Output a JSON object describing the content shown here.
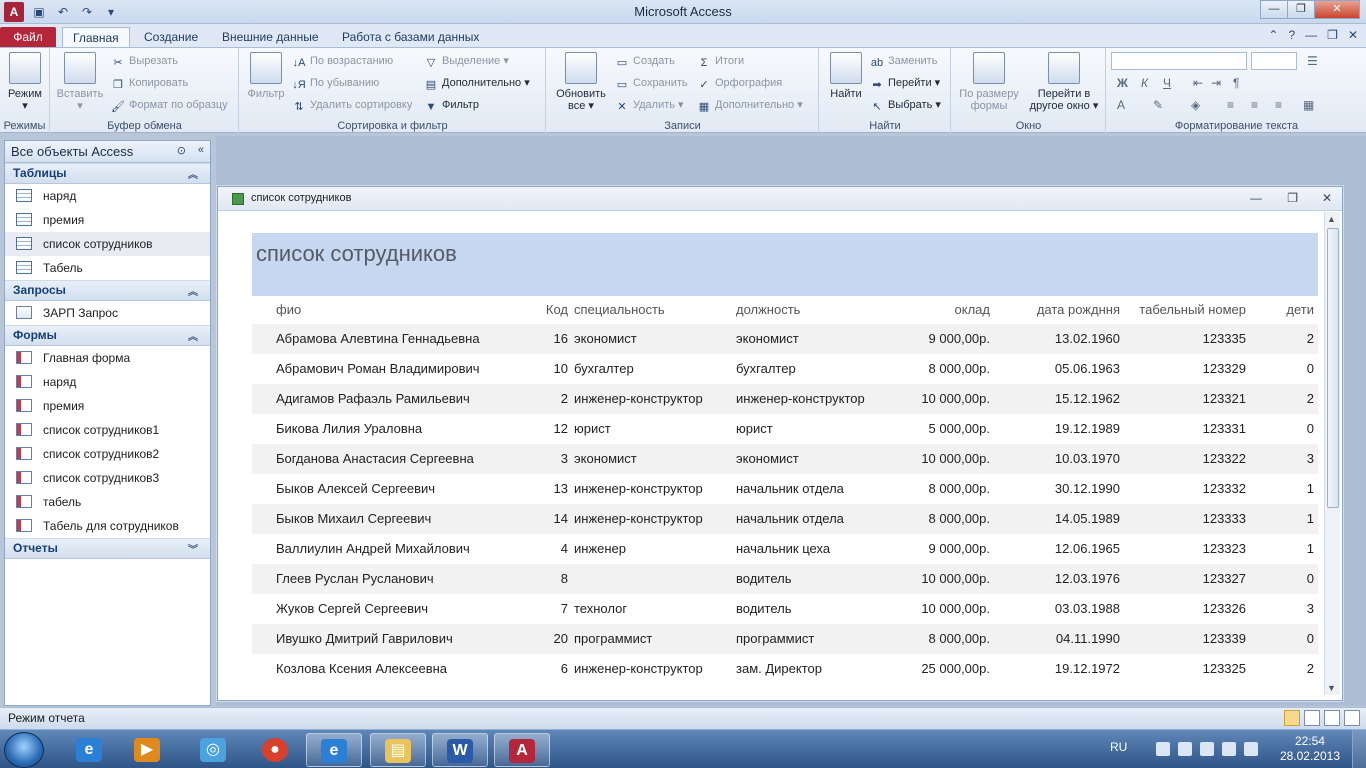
{
  "window": {
    "title": "Microsoft Access"
  },
  "ribbon_tabs": [
    "Файл",
    "Главная",
    "Создание",
    "Внешние данные",
    "Работа с базами данных"
  ],
  "groups": {
    "rezhimy": {
      "label": "Режимы",
      "rezhim": "Режим"
    },
    "bufer": {
      "label": "Буфер обмена",
      "vstavit": "Вставить",
      "vyrezat": "Вырезать",
      "kopirovat": "Копировать",
      "format": "Формат по образцу"
    },
    "sort": {
      "label": "Сортировка и фильтр",
      "filtr": "Фильтр",
      "asc": "По возрастанию",
      "desc": "По убыванию",
      "remove": "Удалить сортировку",
      "vydelenie": "Выделение",
      "dop": "Дополнительно",
      "filtr2": "Фильтр"
    },
    "zapisi": {
      "label": "Записи",
      "obnovit1": "Обновить",
      "obnovit2": "все",
      "sozdat": "Создать",
      "sohranit": "Сохранить",
      "udalit": "Удалить",
      "itogi": "Итоги",
      "orfo": "Орфография",
      "dop": "Дополнительно"
    },
    "nayti": {
      "label": "Найти",
      "nayti": "Найти",
      "zamenit": "Заменить",
      "pereyti": "Перейти",
      "vybrat": "Выбрать"
    },
    "okno": {
      "label": "Окно",
      "razmer1": "По размеру",
      "razmer2": "формы",
      "pereyti1": "Перейти в",
      "pereyti2": "другое окно"
    },
    "format": {
      "label": "Форматирование текста",
      "bold": "Ж",
      "italic": "К",
      "underline": "Ч",
      "fontcolor": "А"
    }
  },
  "nav": {
    "title": "Все объекты Access",
    "sections": [
      {
        "name": "Таблицы",
        "items": [
          "наряд",
          "премия",
          "список сотрудников",
          "Табель"
        ]
      },
      {
        "name": "Запросы",
        "items": [
          "ЗАРП Запрос"
        ]
      },
      {
        "name": "Формы",
        "items": [
          "Главная форма",
          "наряд",
          "премия",
          "список сотрудников1",
          "список сотрудников2",
          "список сотрудников3",
          "табель",
          "Табель для сотрудников"
        ]
      },
      {
        "name": "Отчеты",
        "items": []
      }
    ]
  },
  "report": {
    "window_title": "список сотрудников",
    "heading": "список сотрудников",
    "columns": [
      "фио",
      "Код",
      "специальность",
      "должность",
      "оклад",
      "дата рождння",
      "табельный номер",
      "дети"
    ],
    "rows": [
      [
        "Абрамова Алевтина Геннадьевна",
        "16",
        "экономист",
        "экономист",
        "9 000,00р.",
        "13.02.1960",
        "123335",
        "2"
      ],
      [
        "Абрамович Роман Владимирович",
        "10",
        "бухгалтер",
        "бухгалтер",
        "8 000,00р.",
        "05.06.1963",
        "123329",
        "0"
      ],
      [
        "Адигамов Рафаэль Рамильевич",
        "2",
        "инженер-конструктор",
        "инженер-конструктор",
        "10 000,00р.",
        "15.12.1962",
        "123321",
        "2"
      ],
      [
        "Бикова Лилия Ураловна",
        "12",
        "юрист",
        "юрист",
        "5 000,00р.",
        "19.12.1989",
        "123331",
        "0"
      ],
      [
        "Богданова Анастасия Сергеевна",
        "3",
        "экономист",
        "экономист",
        "10 000,00р.",
        "10.03.1970",
        "123322",
        "3"
      ],
      [
        "Быков Алексей Сергеевич",
        "13",
        "инженер-конструктор",
        "начальник отдела",
        "8 000,00р.",
        "30.12.1990",
        "123332",
        "1"
      ],
      [
        "Быков Михаил Сергеевич",
        "14",
        "инженер-конструктор",
        "начальник отдела",
        "8 000,00р.",
        "14.05.1989",
        "123333",
        "1"
      ],
      [
        "Валлиулин Андрей Михайлович",
        "4",
        "инженер",
        "начальник цеха",
        "9 000,00р.",
        "12.06.1965",
        "123323",
        "1"
      ],
      [
        "Глеев Руслан Русланович",
        "8",
        "",
        "водитель",
        "10 000,00р.",
        "12.03.1976",
        "123327",
        "0"
      ],
      [
        "Жуков Сергей Сергеевич",
        "7",
        "технолог",
        "водитель",
        "10 000,00р.",
        "03.03.1988",
        "123326",
        "3"
      ],
      [
        "Ивушко Дмитрий Гаврилович",
        "20",
        "программист",
        "программист",
        "8 000,00р.",
        "04.11.1990",
        "123339",
        "0"
      ],
      [
        "Козлова Ксения Алексеевна",
        "6",
        "инженер-конструктор",
        "зам. Директор",
        "25 000,00р.",
        "19.12.1972",
        "123325",
        "2"
      ]
    ]
  },
  "status": {
    "text": "Режим отчета"
  },
  "taskbar": {
    "lang": "RU",
    "time": "22:54",
    "date": "28.02.2013"
  }
}
